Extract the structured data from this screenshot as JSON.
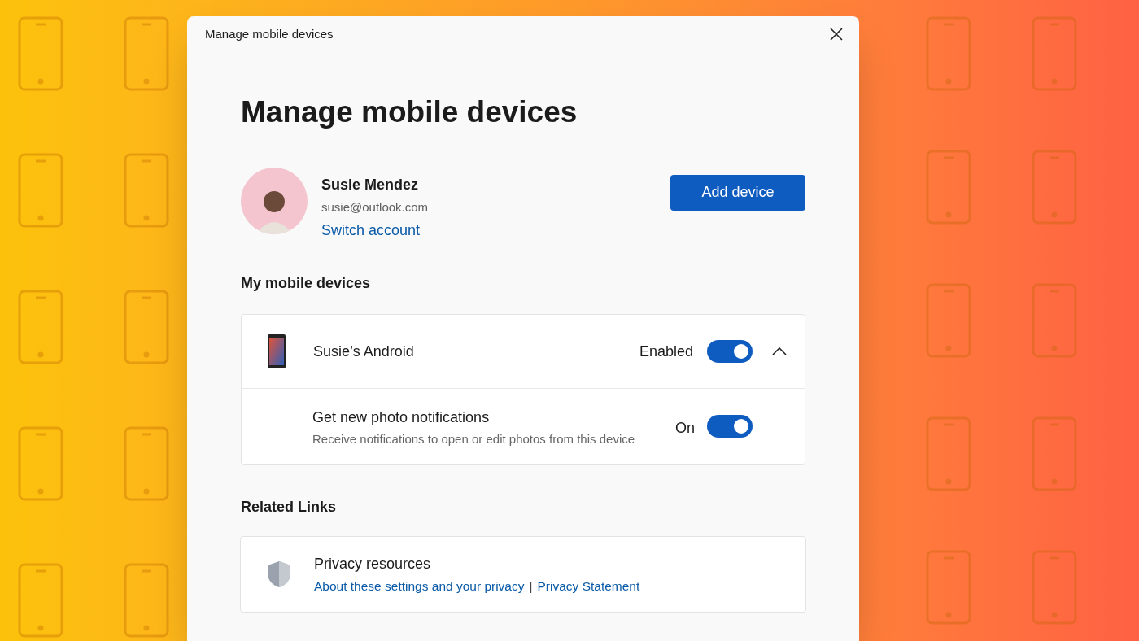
{
  "window": {
    "title": "Manage mobile devices"
  },
  "heading": "Manage mobile devices",
  "account": {
    "name": "Susie Mendez",
    "email": "susie@outlook.com",
    "switch_link": "Switch account"
  },
  "add_button": "Add device",
  "devices_section": {
    "title": "My mobile devices",
    "devices": [
      {
        "name": "Susie’s Android",
        "status": "Enabled",
        "on": true,
        "expanded": true,
        "settings": [
          {
            "title": "Get new photo notifications",
            "description": "Receive notifications to open or edit photos from this device",
            "status": "On",
            "on": true
          }
        ]
      }
    ]
  },
  "related": {
    "title": "Related Links",
    "items": [
      {
        "title": "Privacy resources",
        "links": [
          "About these settings and your privacy",
          "Privacy Statement"
        ],
        "separator": "|"
      }
    ]
  }
}
